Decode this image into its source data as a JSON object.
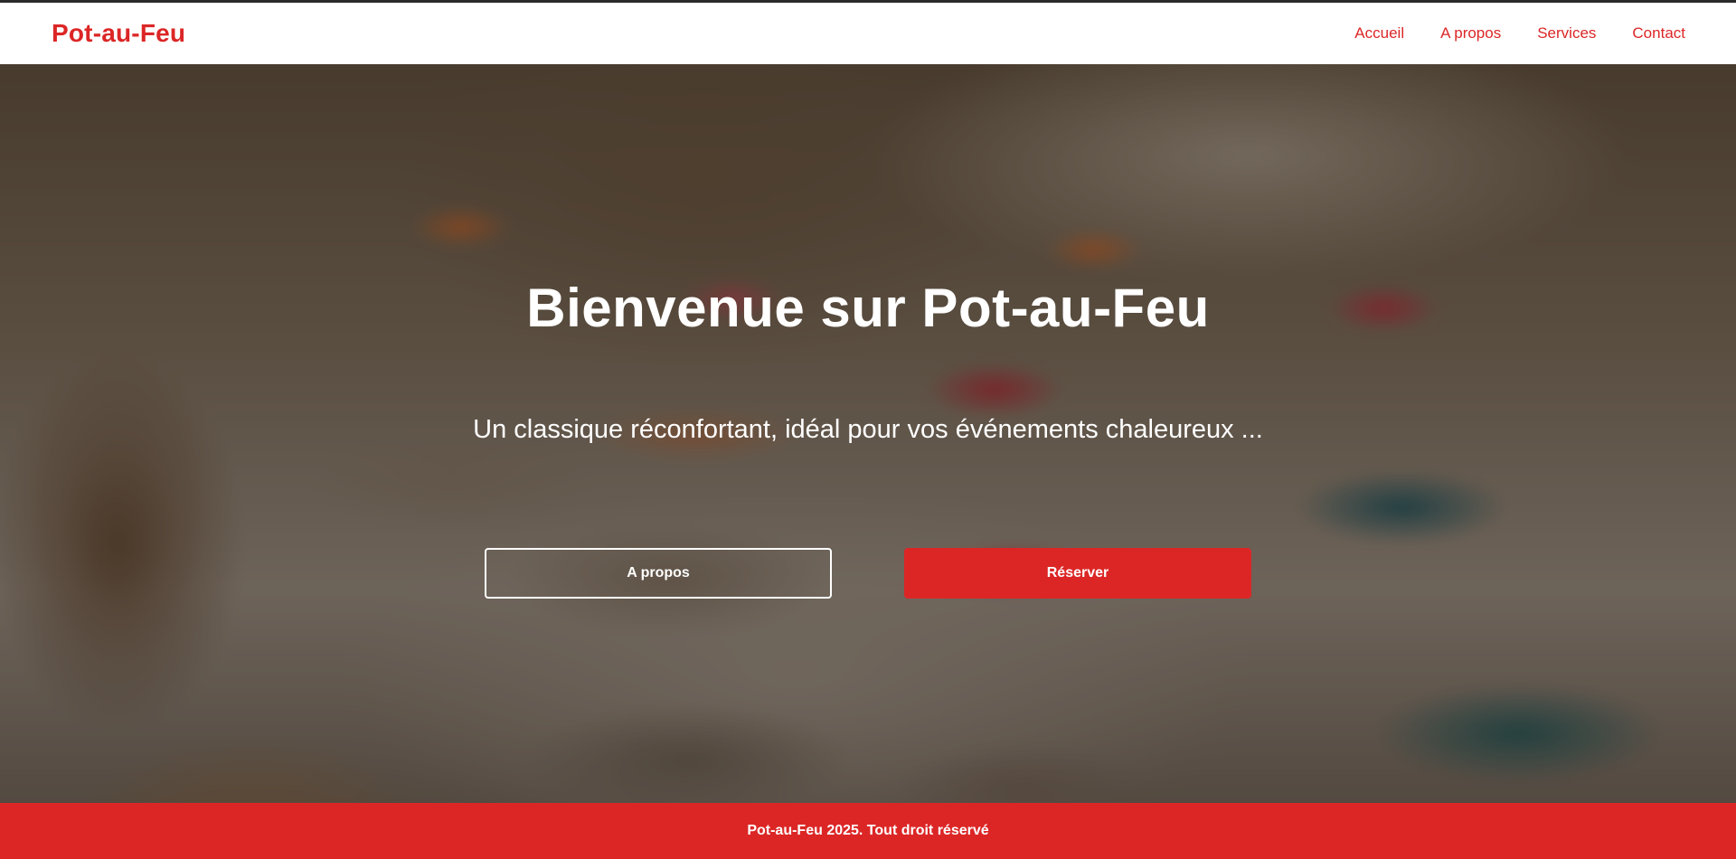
{
  "brand": "Pot-au-Feu",
  "nav": {
    "items": [
      {
        "label": "Accueil"
      },
      {
        "label": "A propos"
      },
      {
        "label": "Services"
      },
      {
        "label": "Contact"
      }
    ]
  },
  "hero": {
    "title": "Bienvenue sur Pot-au-Feu",
    "subtitle": "Un classique réconfortant, idéal pour vos événements chaleureux ...",
    "buttons": {
      "about_label": "A propos",
      "reserve_label": "Réserver"
    }
  },
  "footer": {
    "text": "Pot-au-Feu 2025. Tout droit réservé"
  },
  "colors": {
    "accent": "#dc2626",
    "background": "#ffffff",
    "text_on_hero": "#ffffff"
  }
}
